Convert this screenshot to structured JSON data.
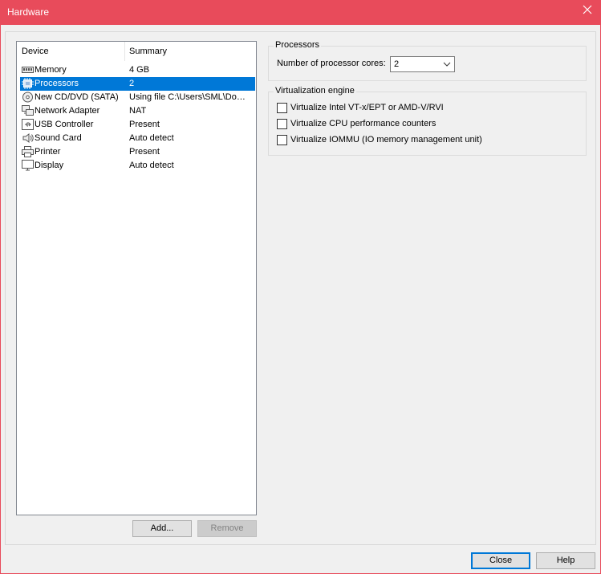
{
  "window": {
    "title": "Hardware",
    "accent_color": "#e84b5b",
    "close_icon": "close-icon"
  },
  "device_list": {
    "columns": [
      "Device",
      "Summary"
    ],
    "selected_color": "#0078d7",
    "items": [
      {
        "name": "Memory",
        "summary": "4 GB",
        "icon": "memory-icon",
        "selected": false
      },
      {
        "name": "Processors",
        "summary": "2",
        "icon": "processor-icon",
        "selected": true
      },
      {
        "name": "New CD/DVD (SATA)",
        "summary": "Using file C:\\Users\\SML\\Dow...",
        "icon": "cd-dvd-icon",
        "selected": false
      },
      {
        "name": "Network Adapter",
        "summary": "NAT",
        "icon": "network-adapter-icon",
        "selected": false
      },
      {
        "name": "USB Controller",
        "summary": "Present",
        "icon": "usb-icon",
        "selected": false
      },
      {
        "name": "Sound Card",
        "summary": "Auto detect",
        "icon": "speaker-icon",
        "selected": false
      },
      {
        "name": "Printer",
        "summary": "Present",
        "icon": "printer-icon",
        "selected": false
      },
      {
        "name": "Display",
        "summary": "Auto detect",
        "icon": "monitor-icon",
        "selected": false
      }
    ],
    "add_label": "Add...",
    "remove_label": "Remove"
  },
  "processors": {
    "group_label": "Processors",
    "cores_label": "Number of processor cores:",
    "cores_value": "2"
  },
  "virtualization": {
    "group_label": "Virtualization engine",
    "options": [
      {
        "label": "Virtualize Intel VT-x/EPT or AMD-V/RVI",
        "checked": false
      },
      {
        "label": "Virtualize CPU performance counters",
        "checked": false
      },
      {
        "label": "Virtualize IOMMU (IO memory management unit)",
        "checked": false
      }
    ]
  },
  "footer": {
    "close_label": "Close",
    "help_label": "Help"
  }
}
